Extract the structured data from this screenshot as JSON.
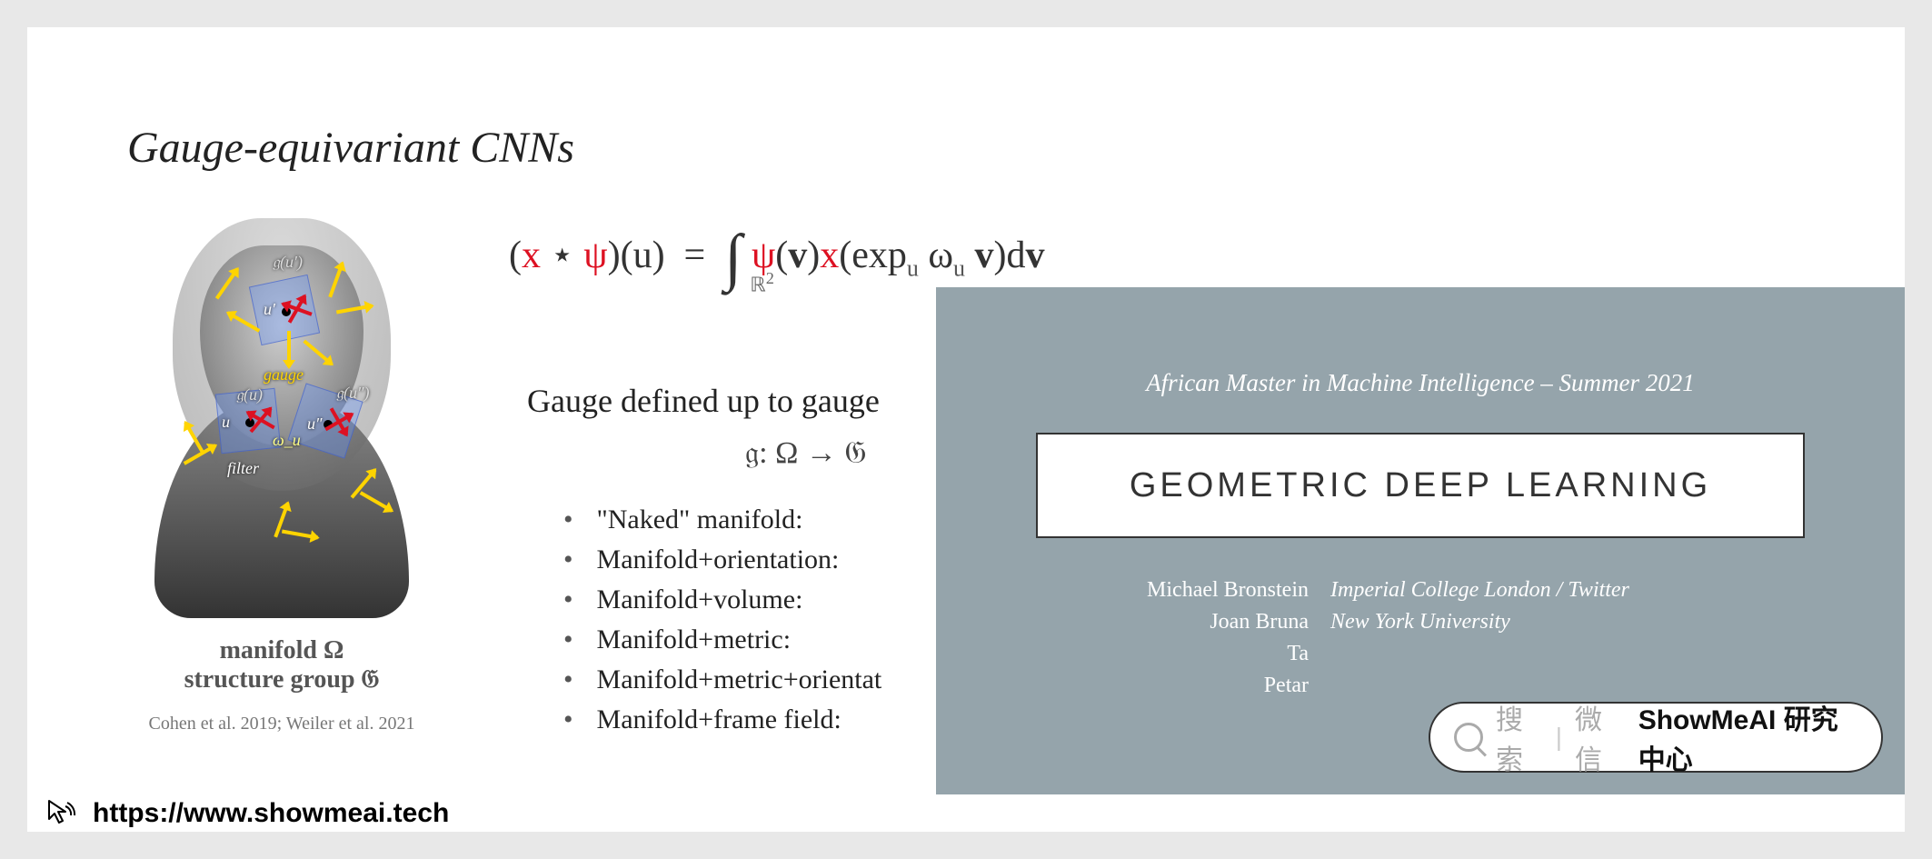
{
  "slide": {
    "title": "Gauge-equivariant CNNs",
    "equation_html": "(<span class='red'>x</span> ⋆ <span class='red'>ψ</span>)(u) &nbsp;=&nbsp; <span class='int'>∫<span class='int-sub'>ℝ<sup>2</sup></span></span>&nbsp;<span class='red'>ψ</span>(<b>v</b>)<span class='red'>x</span>(exp<span class='sub'>u</span> ω<span class='sub'>u</span> <b>v</b>)d<b>v</b>",
    "sub_heading": "Gauge defined up to gauge",
    "map_line": "𝔤: Ω → 𝔊",
    "bullets": [
      "\"Naked\" manifold:",
      "Manifold+orientation:",
      "Manifold+volume:",
      "Manifold+metric:",
      "Manifold+metric+orientat",
      "Manifold+frame field:"
    ],
    "figure": {
      "caption_line1": "manifold Ω",
      "caption_line2": "structure group 𝔊",
      "citation": "Cohen et al. 2019; Weiler et al. 2021",
      "annotations": {
        "gu_prime": "𝔤(u′)",
        "u_prime": "u′",
        "gauge": "gauge",
        "gu": "𝔤(u)",
        "gu_dprime": "𝔤(u″)",
        "u": "u",
        "u_dprime": "u″",
        "omega_u": "ω_u",
        "filter": "filter"
      }
    }
  },
  "overlay": {
    "program": "African Master in Machine Intelligence – Summer 2021",
    "title": "GEOMETRIC DEEP LEARNING",
    "authors": [
      {
        "name": "Michael Bronstein",
        "affiliation": "Imperial College London / Twitter"
      },
      {
        "name": "Joan Bruna",
        "affiliation": "New York University"
      },
      {
        "name": "Ta",
        "affiliation": ""
      },
      {
        "name": "Petar",
        "affiliation": ""
      }
    ]
  },
  "search_chip": {
    "hint": "搜索",
    "separator": "|",
    "hint2": "微信",
    "brand": "ShowMeAI 研究中心"
  },
  "footer": {
    "url": "https://www.showmeai.tech"
  }
}
